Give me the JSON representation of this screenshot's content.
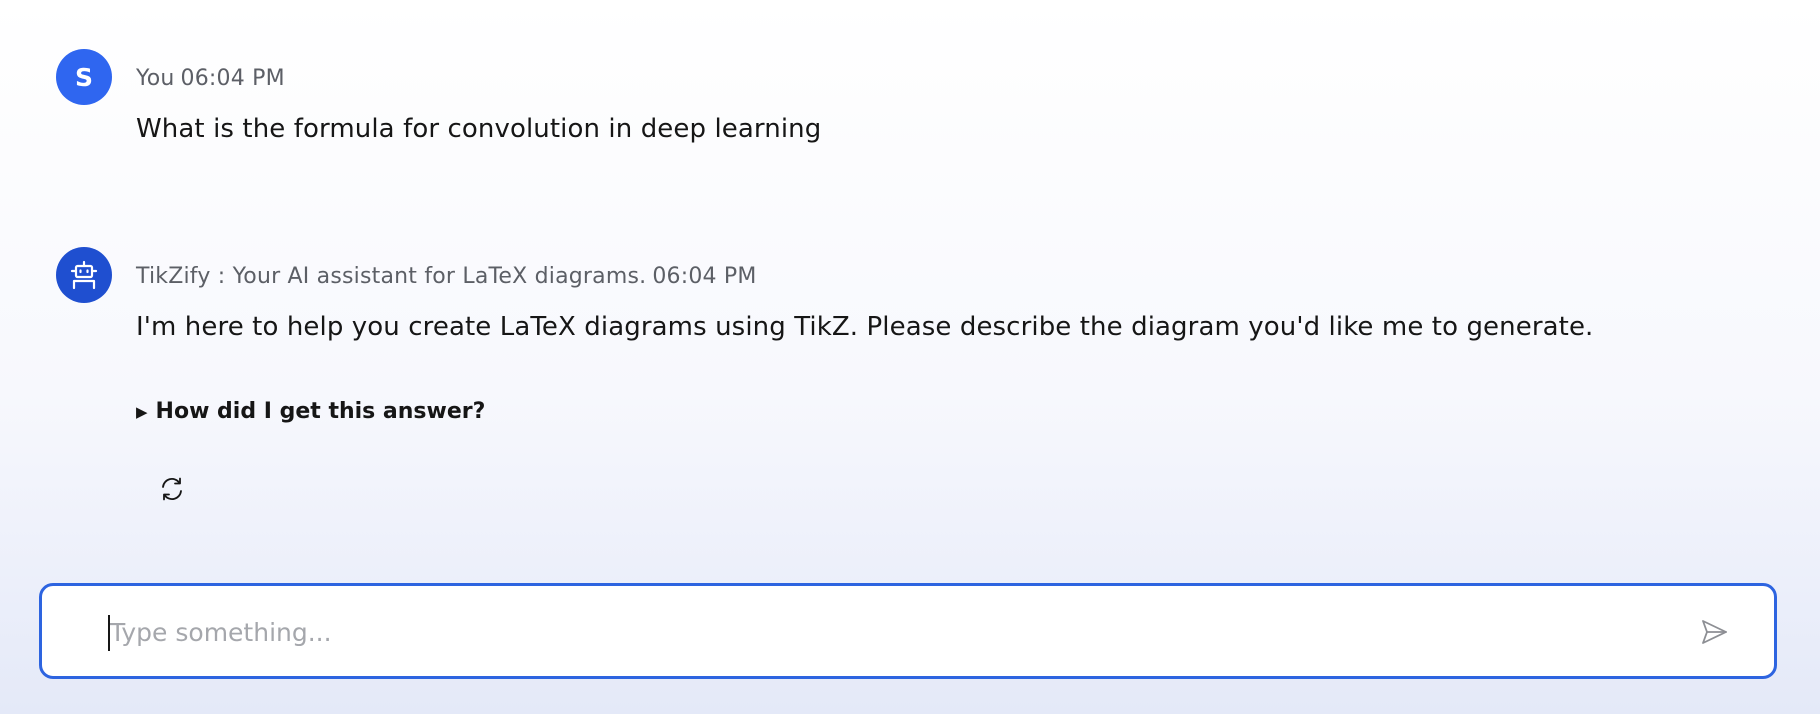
{
  "messages": {
    "user": {
      "avatar_initial": "S",
      "sender": "You",
      "time": "06:04 PM",
      "text": "What is the formula for convolution in deep learning"
    },
    "assistant": {
      "avatar_icon": "robot-icon",
      "sender": "TikZify : Your AI assistant for LaTeX diagrams.",
      "time": "06:04 PM",
      "text": "I'm here to help you create LaTeX diagrams using TikZ. Please describe the diagram you'd like me to generate.",
      "explain_label": "How did I get this answer?",
      "regenerate_icon": "refresh-icon"
    }
  },
  "composer": {
    "placeholder": "Type something...",
    "value": "",
    "send_icon": "send-icon"
  },
  "colors": {
    "accent": "#2d64e0",
    "user_avatar": "#2f66f0",
    "bot_avatar": "#1f4fd0",
    "placeholder": "#a5a7ac"
  }
}
